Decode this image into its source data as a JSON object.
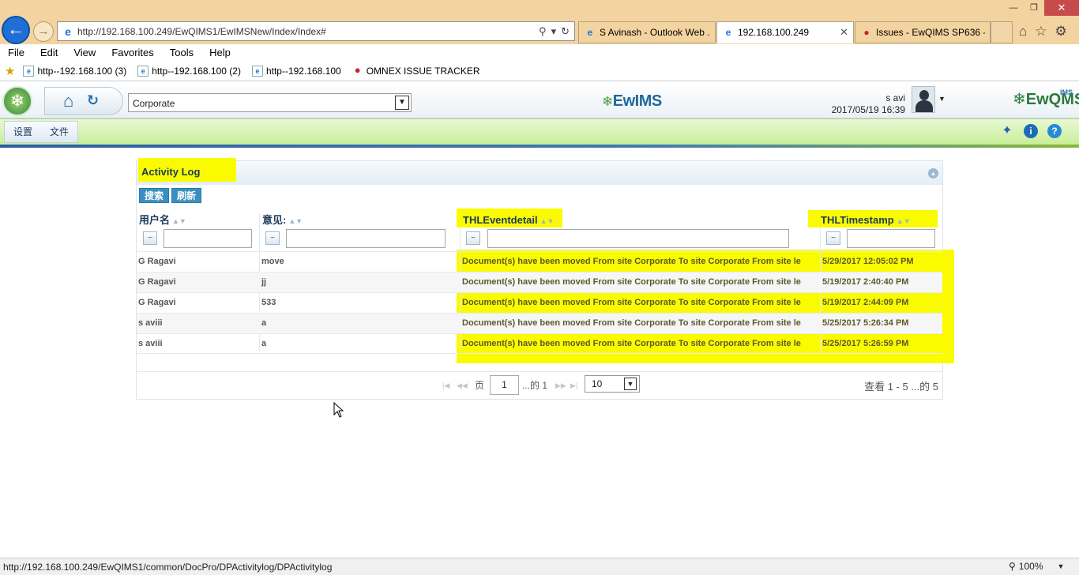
{
  "browser": {
    "address_url": "http://192.168.100.249/EwQIMS1/EwIMSNew/Index/Index#",
    "tabs": [
      {
        "label": "S Avinash - Outlook Web ..."
      },
      {
        "label": "192.168.100.249"
      },
      {
        "label": "Issues - EwQIMS SP636 - ..."
      }
    ],
    "menu": [
      "File",
      "Edit",
      "View",
      "Favorites",
      "Tools",
      "Help"
    ],
    "favorites": [
      {
        "label": "http--192.168.100 (3)"
      },
      {
        "label": "http--192.168.100 (2)"
      },
      {
        "label": "http--192.168.100"
      },
      {
        "label": "OMNEX ISSUE TRACKER"
      }
    ],
    "status_url": "http://192.168.100.249/EwQIMS1/common/DocPro/DPActivitylog/DPActivitylog",
    "zoom": "100%"
  },
  "app": {
    "site_selected": "Corporate",
    "center_logo": "EwIMS",
    "right_logo": "EwQMS",
    "right_logo_sup": "IMS",
    "user_name": "s avi",
    "user_datetime": "2017/05/19 16:39",
    "nav_items": [
      "设置",
      "文件"
    ]
  },
  "panel": {
    "title": "Activity Log",
    "actions": [
      "搜索",
      "刷新"
    ],
    "columns": [
      "用户名",
      "意见:",
      "THLEventdetail",
      "THLTimestamp"
    ],
    "filter_symbol": "~",
    "rows": [
      {
        "user": "G Ragavi",
        "comment": "move",
        "event": "Document(s) have been moved From site Corporate To site Corporate From site le",
        "timestamp": "5/29/2017 12:05:02 PM"
      },
      {
        "user": "G Ragavi",
        "comment": "jj",
        "event": "Document(s) have been moved From site Corporate To site Corporate From site le",
        "timestamp": "5/19/2017 2:40:40 PM"
      },
      {
        "user": "G Ragavi",
        "comment": "533",
        "event": "Document(s) have been moved From site Corporate To site Corporate From site le",
        "timestamp": "5/19/2017 2:44:09 PM"
      },
      {
        "user": "s aviii",
        "comment": "a",
        "event": "Document(s) have been moved From site Corporate To site Corporate From site le",
        "timestamp": "5/25/2017 5:26:34 PM"
      },
      {
        "user": "s aviii",
        "comment": "a",
        "event": "Document(s) have been moved From site Corporate To site Corporate From site le",
        "timestamp": "5/25/2017 5:26:59 PM"
      }
    ],
    "pager": {
      "page_label": "页",
      "page_value": "1",
      "of_label": "...的 1",
      "page_size": "10",
      "info": "查看 1 - 5 ...的 5"
    }
  }
}
